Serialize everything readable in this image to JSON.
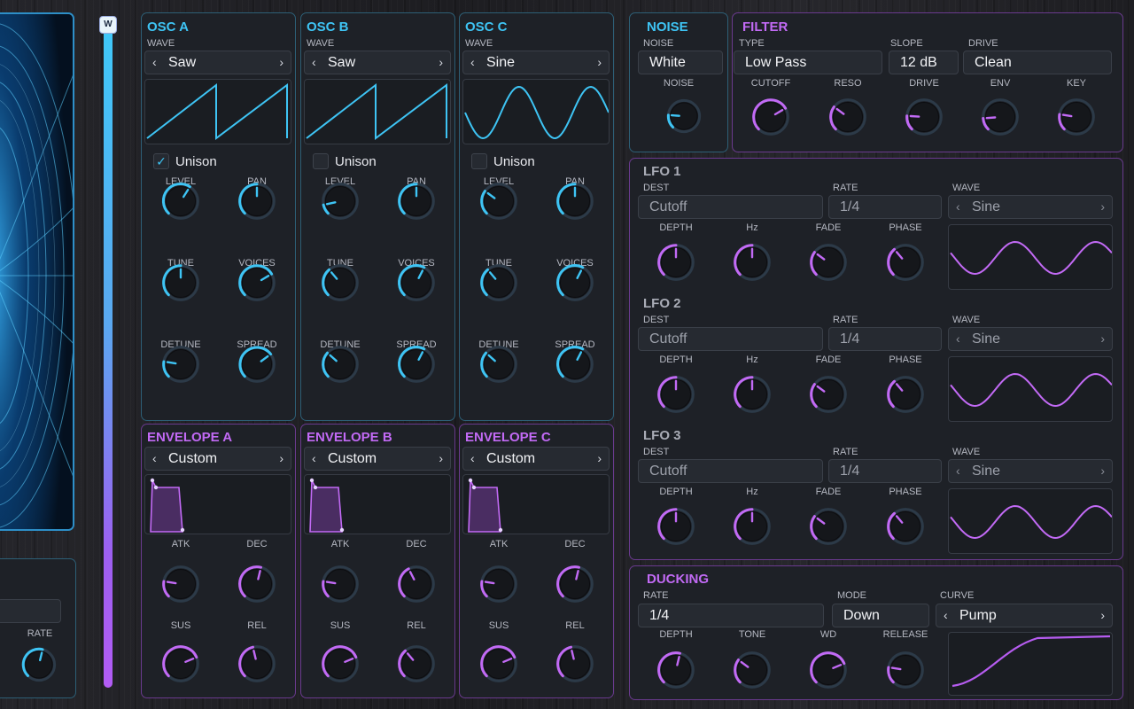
{
  "colors": {
    "cyan": "#3ec4f4",
    "purple": "#c26af5",
    "panel": "#1e2127"
  },
  "slider": {
    "label": "W",
    "value": 1.0
  },
  "left_panel": {
    "rate_label": "RATE"
  },
  "osc": [
    {
      "title": "OSC A",
      "wave_label": "WAVE",
      "wave": "Saw",
      "wave_shape": "saw",
      "unison_label": "Unison",
      "unison": true,
      "knobs": [
        {
          "label": "LEVEL"
        },
        {
          "label": "PAN"
        },
        {
          "label": "TUNE"
        },
        {
          "label": "VOICES"
        },
        {
          "label": "DETUNE"
        },
        {
          "label": "SPREAD"
        }
      ]
    },
    {
      "title": "OSC B",
      "wave_label": "WAVE",
      "wave": "Saw",
      "wave_shape": "saw",
      "unison_label": "Unison",
      "unison": false,
      "knobs": [
        {
          "label": "LEVEL"
        },
        {
          "label": "PAN"
        },
        {
          "label": "TUNE"
        },
        {
          "label": "VOICES"
        },
        {
          "label": "DETUNE"
        },
        {
          "label": "SPREAD"
        }
      ]
    },
    {
      "title": "OSC C",
      "wave_label": "WAVE",
      "wave": "Sine",
      "wave_shape": "sine",
      "unison_label": "Unison",
      "unison": false,
      "knobs": [
        {
          "label": "LEVEL"
        },
        {
          "label": "PAN"
        },
        {
          "label": "TUNE"
        },
        {
          "label": "VOICES"
        },
        {
          "label": "DETUNE"
        },
        {
          "label": "SPREAD"
        }
      ]
    }
  ],
  "envelopes": [
    {
      "title": "ENVELOPE A",
      "preset": "Custom",
      "knobs": [
        {
          "label": "ATK"
        },
        {
          "label": "DEC"
        },
        {
          "label": "SUS"
        },
        {
          "label": "REL"
        }
      ]
    },
    {
      "title": "ENVELOPE B",
      "preset": "Custom",
      "knobs": [
        {
          "label": "ATK"
        },
        {
          "label": "DEC"
        },
        {
          "label": "SUS"
        },
        {
          "label": "REL"
        }
      ]
    },
    {
      "title": "ENVELOPE C",
      "preset": "Custom",
      "knobs": [
        {
          "label": "ATK"
        },
        {
          "label": "DEC"
        },
        {
          "label": "SUS"
        },
        {
          "label": "REL"
        }
      ]
    }
  ],
  "noise": {
    "title": "NOISE",
    "type_label": "NOISE",
    "type": "White",
    "knob_label": "NOISE"
  },
  "filter": {
    "title": "FILTER",
    "type_label": "TYPE",
    "type": "Low Pass",
    "slope_label": "SLOPE",
    "slope": "12 dB",
    "drive_label": "DRIVE",
    "drive": "Clean",
    "knobs": [
      {
        "label": "CUTOFF"
      },
      {
        "label": "RESO"
      },
      {
        "label": "DRIVE"
      },
      {
        "label": "ENV"
      },
      {
        "label": "KEY"
      }
    ]
  },
  "lfos": [
    {
      "title": "LFO 1",
      "dest_label": "DEST",
      "dest": "Cutoff",
      "rate_label": "RATE",
      "rate": "1/4",
      "wave_label": "WAVE",
      "wave": "Sine",
      "knobs": [
        {
          "label": "DEPTH"
        },
        {
          "label": "Hz"
        },
        {
          "label": "FADE"
        },
        {
          "label": "PHASE"
        }
      ]
    },
    {
      "title": "LFO 2",
      "dest_label": "DEST",
      "dest": "Cutoff",
      "rate_label": "RATE",
      "rate": "1/4",
      "wave_label": "WAVE",
      "wave": "Sine",
      "knobs": [
        {
          "label": "DEPTH"
        },
        {
          "label": "Hz"
        },
        {
          "label": "FADE"
        },
        {
          "label": "PHASE"
        }
      ]
    },
    {
      "title": "LFO 3",
      "dest_label": "DEST",
      "dest": "Cutoff",
      "rate_label": "RATE",
      "rate": "1/4",
      "wave_label": "WAVE",
      "wave": "Sine",
      "knobs": [
        {
          "label": "DEPTH"
        },
        {
          "label": "Hz"
        },
        {
          "label": "FADE"
        },
        {
          "label": "PHASE"
        }
      ]
    }
  ],
  "ducking": {
    "title": "DUCKING",
    "rate_label": "RATE",
    "rate": "1/4",
    "mode_label": "MODE",
    "mode": "Down",
    "curve_label": "CURVE",
    "curve": "Pump",
    "knobs": [
      {
        "label": "DEPTH"
      },
      {
        "label": "TONE"
      },
      {
        "label": "WD"
      },
      {
        "label": "RELEASE"
      }
    ]
  }
}
